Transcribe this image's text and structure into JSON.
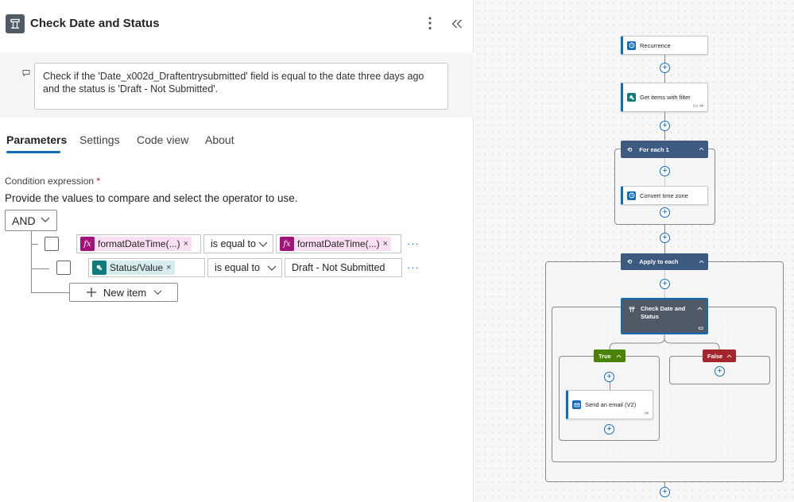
{
  "header": {
    "title": "Check Date and Status",
    "more": "⋮",
    "collapse": "«"
  },
  "description": "Check if the 'Date_x002d_Draftentrysubmitted' field is equal to the date three days ago and the status is 'Draft - Not Submitted'.",
  "tabs": [
    {
      "label": "Parameters",
      "active": true
    },
    {
      "label": "Settings"
    },
    {
      "label": "Code view"
    },
    {
      "label": "About"
    }
  ],
  "condition": {
    "label": "Condition expression",
    "required_mark": "*",
    "help": "Provide the values to compare and select the operator to use.",
    "group_operator": "AND",
    "rows": [
      {
        "left_token": "formatDateTime(...)",
        "operator": "is equal to",
        "right_token": "formatDateTime(...)",
        "more": "···"
      },
      {
        "left_token": "Status/Value",
        "operator": "is equal to",
        "right_value": "Draft - Not Submitted",
        "more": "···"
      }
    ],
    "new_item": "New item",
    "remove": "×"
  },
  "canvas": {
    "recurrence": "Recurrence",
    "get_items": "Get items with filter",
    "for_each": "For each 1",
    "convert_tz": "Convert time zone",
    "apply_each": "Apply to each",
    "check_line1": "Check Date and",
    "check_line2": "Status",
    "true_label": "True",
    "false_label": "False",
    "send_email": "Send an email (V2)",
    "plus": "+"
  },
  "colors": {
    "accent": "#0f6cbd",
    "scope_header": "#3d5a80",
    "selected_node": "#4f5a66",
    "true_branch": "#498205",
    "false_branch": "#a4262c",
    "fx_token": "#a3117a",
    "sp_token": "#117a7a"
  }
}
